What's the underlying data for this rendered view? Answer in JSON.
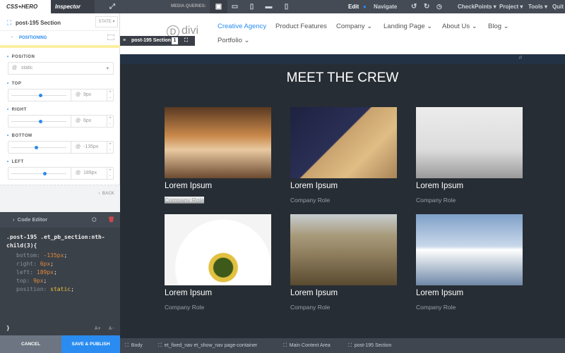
{
  "topbar": {
    "brand": "CSS+HERO",
    "inspector_tab": "Inspector",
    "media_queries_label": "MEDIA QUERIES:",
    "edit": "Edit",
    "navigate": "Navigate",
    "menus": [
      "CheckPoints ▾",
      "Project ▾",
      "Tools ▾",
      "Quit"
    ]
  },
  "inspector": {
    "selector": "post-195 Section",
    "state_label": "STATE ▾",
    "group": "POSITIONING",
    "fields": [
      {
        "label": "POSITION",
        "value": "static"
      },
      {
        "label": "TOP",
        "value": "9px",
        "slider": 0.5
      },
      {
        "label": "RIGHT",
        "value": "6px",
        "slider": 0.5
      },
      {
        "label": "BOTTOM",
        "value": "-135px",
        "slider": 0.43
      },
      {
        "label": "LEFT",
        "value": "189px",
        "slider": 0.6
      }
    ],
    "back": "BACK"
  },
  "code_editor": {
    "title": "Code Editor",
    "selector": ".post-195 .et_pb_section:nth-",
    "selector2": "child(3){",
    "lines": [
      {
        "p": "bottom:",
        "v": " -135px"
      },
      {
        "p": "right:",
        "v": " 6px"
      },
      {
        "p": "left:",
        "v": " 189px"
      },
      {
        "p": "top:",
        "v": " 9px"
      },
      {
        "p": "position:",
        "v": " static"
      }
    ],
    "close": "}",
    "font_up": "A+",
    "font_down": "A-"
  },
  "buttons": {
    "cancel": "CANCEL",
    "save": "SAVE & PUBLISH"
  },
  "site": {
    "logo": "divi",
    "nav": [
      "Creative Agency",
      "Product Features",
      "Company ⌄",
      "Landing Page ⌄",
      "About Us ⌄",
      "Blog ⌄",
      "Portfolio ⌄"
    ],
    "badge_label": "post-195 Section",
    "badge_count": "1",
    "heading": "MEET THE CREW",
    "cards": [
      {
        "name": "Lorem Ipsum",
        "role": "Company Role"
      },
      {
        "name": "Lorem Ipsum",
        "role": "Company Role"
      },
      {
        "name": "Lorem Ipsum",
        "role": "Company Role"
      },
      {
        "name": "Lorem Ipsum",
        "role": "Company Role"
      },
      {
        "name": "Lorem Ipsum",
        "role": "Company Role"
      },
      {
        "name": "Lorem Ipsum",
        "role": "Company Role"
      }
    ]
  },
  "breadcrumbs": [
    "Body",
    "et_fixed_nav et_show_nav page-container",
    "Main Content Area",
    "post-195 Section"
  ],
  "colors": {
    "accent": "#2a8cf0",
    "topbar": "#454b55",
    "site_bg": "#262d34"
  }
}
